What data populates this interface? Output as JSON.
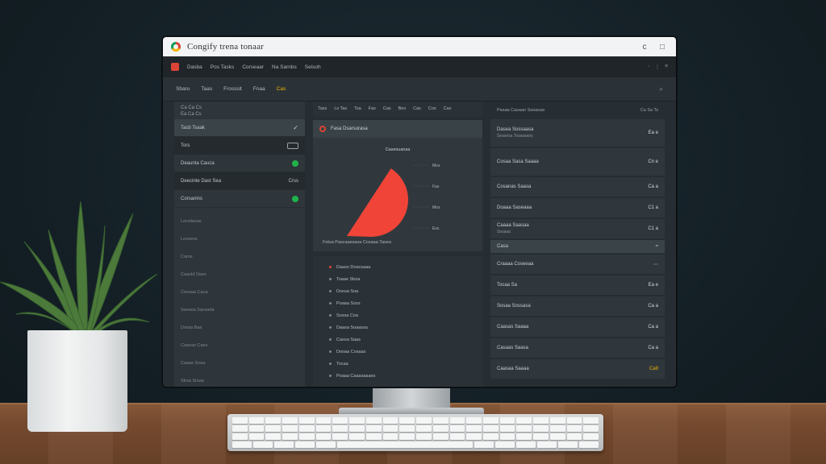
{
  "browser": {
    "title": "Congify  trena  tonaar",
    "controls": [
      "c",
      "□"
    ]
  },
  "navbar": {
    "items": [
      "Dasba",
      "Pos Tasks",
      "Corseaar",
      "Na Sarnbs",
      "Seisoh"
    ],
    "right": [
      "◦",
      "⋮",
      "≡"
    ]
  },
  "toolbar": {
    "items": [
      "Sbaru",
      "Taas",
      "Frosssit",
      "Fnaa",
      "Cas"
    ],
    "search_icon": "search-icon"
  },
  "left_panel": {
    "head_lines": [
      "Ca  Ca  Cs",
      "Ea  Ca  Cs"
    ],
    "rows": [
      {
        "label": "Tasb  Tsaak",
        "control": "check"
      },
      {
        "label": "Tors",
        "control": "toggle"
      },
      {
        "label": "Deaunta Cauca",
        "control": "green"
      },
      {
        "label": "Deecinte Dast Sea",
        "control": "text",
        "text": "Crss"
      },
      {
        "label": "Corsanins",
        "control": "green"
      }
    ],
    "faint_lines": [
      "Lorsdeeas",
      "Loosens",
      "Caros",
      "Caauld Daes",
      "Ceosaa Caua",
      "Seeasa Sacsada",
      "Doraa Baa",
      "Caanas Caes",
      "Caaas Soaa",
      "Sboa Srsaa"
    ]
  },
  "middle_panel": {
    "tabs": [
      "Tass",
      "Ls  Tas",
      "Tsa",
      "Fas",
      "Cas",
      "Bes",
      "Cas",
      "Cos",
      "Cas"
    ],
    "chart_header": "Fasa Dsarsurasa",
    "chart_title": "Casesuansa",
    "chart_caption": "Fotsa  Pascaaesasa  Cosaaa  Tasea",
    "chart_data": {
      "type": "pie",
      "slices": [
        {
          "label": "",
          "value": 42,
          "color": "#f04438"
        }
      ],
      "tick_labels": [
        "Mos",
        "Fas",
        "Mos",
        "Ess"
      ]
    },
    "list": [
      {
        "label": "Daaso Doacsaaa",
        "accent": true
      },
      {
        "label": "Toaae Sboa"
      },
      {
        "label": "Dseua Soa"
      },
      {
        "label": "Poaaa Soss"
      },
      {
        "label": "Sussa Coa"
      },
      {
        "label": "Daasa Soaassa"
      },
      {
        "label": "Casoa Saas"
      },
      {
        "label": "Dooaa Cosaas"
      },
      {
        "label": "Tocaa"
      },
      {
        "label": "Poaaa Caaasaaaes"
      }
    ]
  },
  "right_panel": {
    "head": "Pasaa Casaao Sasasaa",
    "head_right": "Ca  Sa  Ts",
    "rows": [
      {
        "label": "Dasea Sossaasa",
        "sub": "Seasnsa  Tosaasans",
        "value": "Ea e",
        "tall": true
      },
      {
        "label": "Cosaa Sasa Saaaa",
        "value": "Cn e",
        "tall": true
      },
      {
        "label": "Cosanas Saasa",
        "value": "Ca a"
      },
      {
        "label": "Doaaa Saseaaa",
        "value": "C1 a"
      },
      {
        "label": "Caaaa Saasaa",
        "sub": "Sosaaa",
        "value": "C1 a"
      },
      {
        "label": "Casa",
        "value": "≈",
        "band": true
      },
      {
        "label": "Craaaa Coseeaa",
        "value": "⋯"
      },
      {
        "label": "Tocaa Sa",
        "value": "Ea e"
      },
      {
        "label": "Sosaa Sossasa",
        "value": "Ca a"
      },
      {
        "label": "Caasas Saaaa",
        "value": "Ca a"
      },
      {
        "label": "Casaas Saasa",
        "value": "Ca a"
      },
      {
        "label": "Caasaa Saaaa",
        "value": "Ca9",
        "orange": true
      }
    ]
  }
}
